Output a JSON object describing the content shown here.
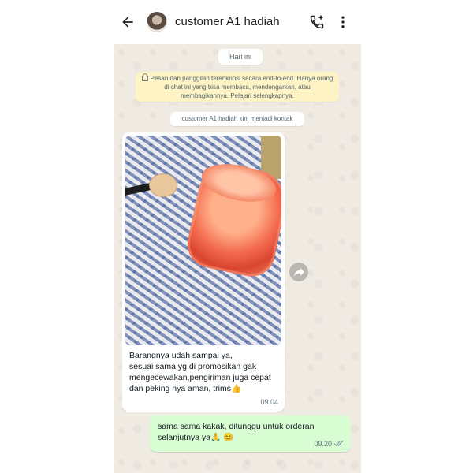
{
  "header": {
    "contact_name": "customer A1 hadiah"
  },
  "chat": {
    "date_chip": "Hari ini",
    "encryption_notice": "Pesan dan panggilan terenkripsi secara end-to-end. Hanya orang di chat ini yang bisa membaca, mendengarkan, atau membagikannya. Pelajari selengkapnya.",
    "system_notice": "customer A1 hadiah kini menjadi kontak",
    "incoming": {
      "lines": [
        "Barangnya udah sampai ya,",
        "sesuai sama yg di promosikan gak",
        "mengecewakan,pengiriman juga cepat",
        "dan peking nya aman, trims👍"
      ],
      "time": "09.04"
    },
    "outgoing": {
      "lines": [
        "sama sama kakak, ditunggu untuk orderan",
        "selanjutnya ya🙏 😊"
      ],
      "time": "09.20"
    }
  },
  "icons": {
    "back": "arrow-back-icon",
    "call_add": "call-add-icon",
    "more": "more-vert-icon",
    "lock": "lock-icon",
    "forward": "forward-icon",
    "read_ticks": "double-check-icon"
  },
  "colors": {
    "chat_background": "#efeae2",
    "outgoing_bubble": "#d9fdd3",
    "incoming_bubble": "#ffffff",
    "encryption_bubble": "#fdf3c4"
  }
}
